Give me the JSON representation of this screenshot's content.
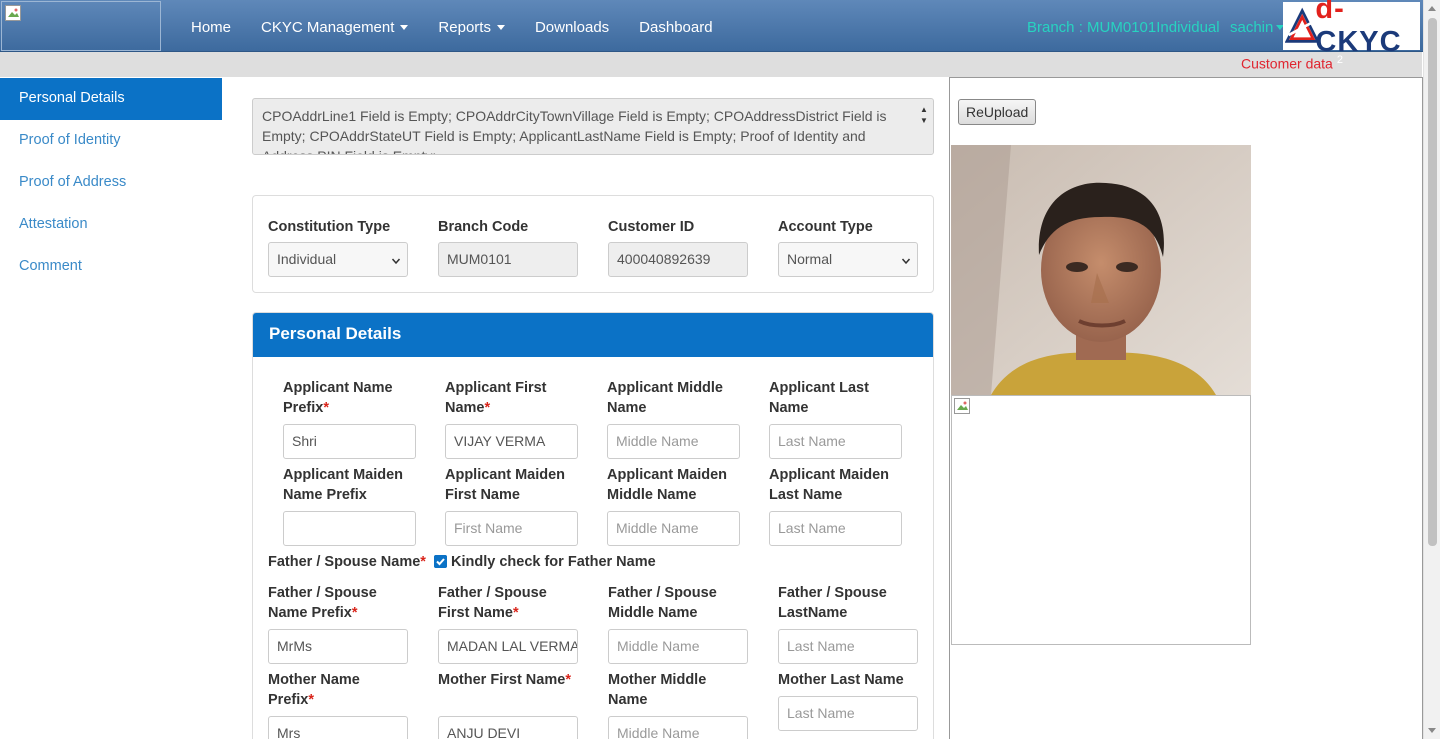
{
  "nav": {
    "items": [
      "Home",
      "CKYC Management",
      "Reports",
      "Downloads",
      "Dashboard"
    ],
    "branch": "Branch : MUM0101Individual",
    "user": "sachin",
    "brand": {
      "prefix": "d-",
      "name": "CKYC"
    }
  },
  "subbar": {
    "customer_data": "Customer data",
    "count": "2"
  },
  "sidebar": {
    "items": [
      "Personal Details",
      "Proof of Identity",
      "Proof of Address",
      "Attestation",
      "Comment"
    ]
  },
  "error_text": "CPOAddrLine1 Field is Empty; CPOAddrCityTownVillage Field is Empty; CPOAddressDistrict Field is Empty; CPOAddrStateUT Field is Empty; ApplicantLastName Field is Empty; Proof of Identity and Address PIN Field is Empty;",
  "top_fields": {
    "constitution_type": {
      "label": "Constitution Type",
      "value": "Individual"
    },
    "branch_code": {
      "label": "Branch Code",
      "value": "MUM0101"
    },
    "customer_id": {
      "label": "Customer ID",
      "value": "400040892639"
    },
    "account_type": {
      "label": "Account Type",
      "value": "Normal"
    }
  },
  "personal": {
    "title": "Personal Details",
    "applicant": {
      "prefix": {
        "label": "Applicant Name Prefix",
        "value": "Shri"
      },
      "first": {
        "label": "Applicant First Name",
        "value": "VIJAY VERMA"
      },
      "middle": {
        "label": "Applicant Middle Name",
        "placeholder": "Middle Name"
      },
      "last": {
        "label": "Applicant Last Name",
        "placeholder": "Last Name"
      }
    },
    "maiden": {
      "prefix": {
        "label": "Applicant Maiden Name Prefix",
        "value": ""
      },
      "first": {
        "label": "Applicant Maiden First Name",
        "placeholder": "First Name"
      },
      "middle": {
        "label": "Applicant Maiden Middle Name",
        "placeholder": "Middle Name"
      },
      "last": {
        "label": "Applicant Maiden Last Name",
        "placeholder": "Last Name"
      }
    },
    "father_spouse_label": "Father / Spouse Name",
    "kindly_check": "Kindly check for Father Name",
    "father": {
      "prefix": {
        "label": "Father / Spouse Name Prefix",
        "value": "MrMs"
      },
      "first": {
        "label": "Father / Spouse First Name",
        "value": "MADAN LAL VERMA"
      },
      "middle": {
        "label": "Father / Spouse Middle Name",
        "placeholder": "Middle Name"
      },
      "last": {
        "label": "Father / Spouse LastName",
        "placeholder": "Last Name"
      }
    },
    "mother": {
      "prefix": {
        "label": "Mother Name Prefix",
        "value": "Mrs"
      },
      "first": {
        "label": "Mother First Name",
        "value": "ANJU DEVI"
      },
      "middle": {
        "label": "Mother Middle Name",
        "placeholder": "Middle Name"
      },
      "last": {
        "label": "Mother Last Name",
        "placeholder": "Last Name"
      }
    }
  },
  "right": {
    "reupload": "ReUpload"
  },
  "colors": {
    "nav_top": "#5f88b9",
    "nav_bottom": "#3d6a9e",
    "accent_blue": "#0b72c6",
    "teal": "#27d3c0",
    "required_red": "#d9241a"
  }
}
